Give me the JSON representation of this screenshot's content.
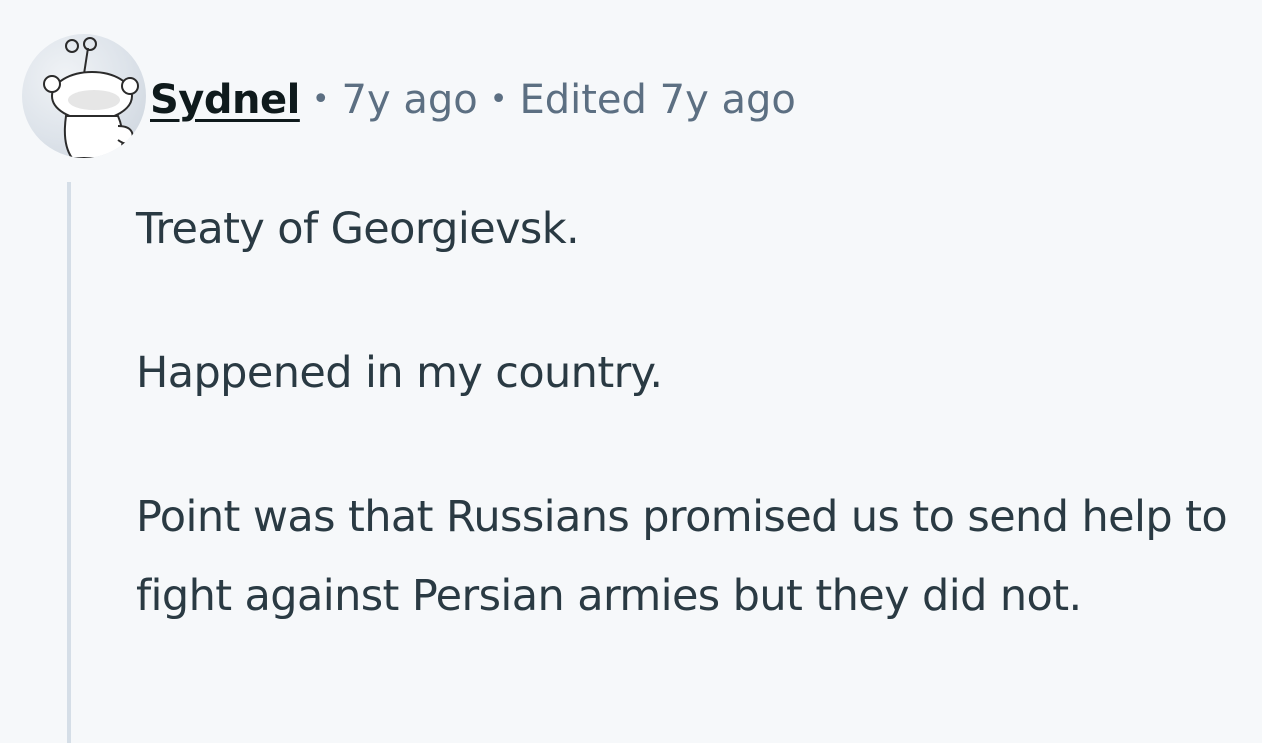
{
  "comment": {
    "author": "Sydnel",
    "separator": "•",
    "age": "7y ago",
    "edited": "Edited 7y ago",
    "avatar_icon": "snoo-avatar-icon",
    "paragraphs": [
      "Treaty of Georgievsk.",
      "Happened in my country.",
      "Point was that Russians promised us to send help to fight against Persian armies but they did not."
    ]
  }
}
